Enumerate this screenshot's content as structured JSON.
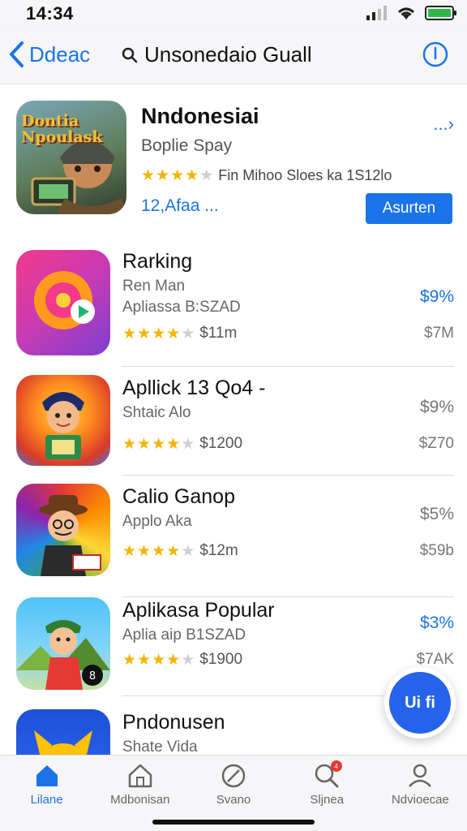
{
  "status": {
    "time": "14:34"
  },
  "nav": {
    "back_label": "Ddeac",
    "search_text": "Unsonedaio Guall"
  },
  "featured": {
    "title": "Nndonesiai",
    "subtitle": "Boplie Spay",
    "rating": 3.5,
    "rating_text": "Fin Mihoo Sloes ka 1S12lo",
    "count": "12,Afaa ...",
    "more_label": "...›",
    "button_label": "Asurten",
    "icon_text": "Dontia Npoulask"
  },
  "apps": [
    {
      "title": "Rarking",
      "sub1": "Ren Man",
      "sub2": "Apliassa B:SZAD",
      "rating": 3.5,
      "rating_text": "$11m",
      "price": "$9%",
      "price2": "$7M"
    },
    {
      "title": "Apllick 13 Qo4 -",
      "sub1": "Shtaic Alo",
      "sub2": "",
      "rating": 3.5,
      "rating_text": "$1200",
      "price": "$9%",
      "price2": "$Z70"
    },
    {
      "title": "Calio Ganop",
      "sub1": "Applo Aka",
      "sub2": "",
      "rating": 3.5,
      "rating_text": "$12m",
      "price": "$5%",
      "price2": "$59b"
    },
    {
      "title": "Aplikasa Popular",
      "sub1": "Aplia aip B1SZAD",
      "sub2": "",
      "rating": 3.5,
      "rating_text": "$1900",
      "price": "$3%",
      "price2": "$7AK"
    },
    {
      "title": "Pndonusen",
      "sub1": "Shate Vida",
      "sub2": "",
      "rating": 0,
      "rating_text": "",
      "price": "",
      "price2": ""
    }
  ],
  "fab": {
    "label": "Ui fi"
  },
  "tabs": [
    {
      "label": "Lilane",
      "icon": "home-icon",
      "active": true
    },
    {
      "label": "Mdbonisan",
      "icon": "house-outline-icon",
      "active": false
    },
    {
      "label": "Svano",
      "icon": "compass-icon",
      "active": false
    },
    {
      "label": "Sljnea",
      "icon": "search-icon",
      "active": false,
      "badge": "4"
    },
    {
      "label": "Ndvioecae",
      "icon": "person-icon",
      "active": false
    }
  ],
  "colors": {
    "accent": "#1a73e8",
    "star": "#f5b400",
    "fab": "#2563eb"
  }
}
